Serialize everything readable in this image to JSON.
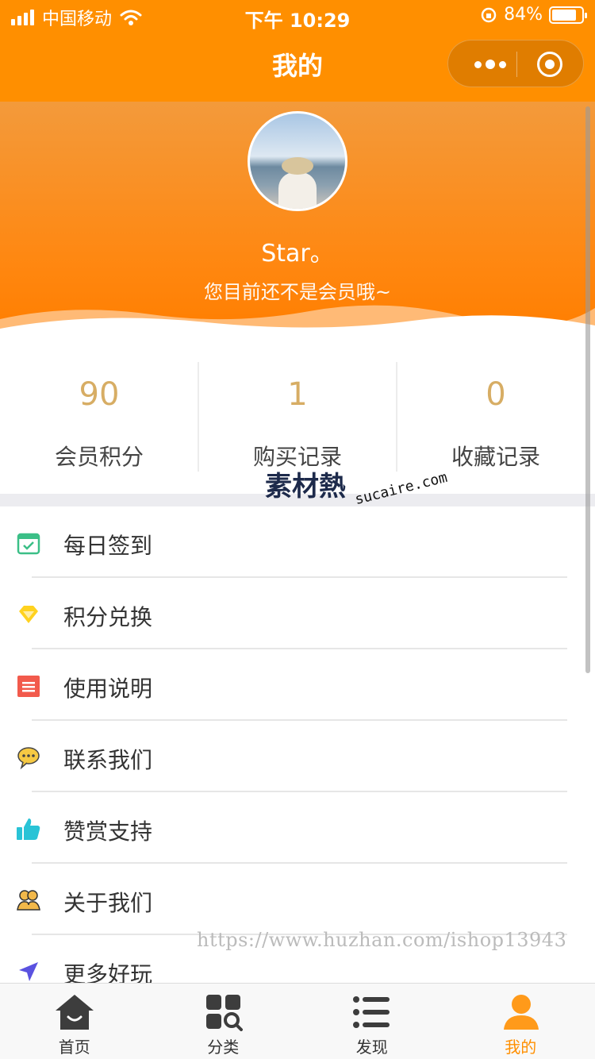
{
  "status_bar": {
    "carrier": "中国移动",
    "time": "下午 10:29",
    "battery": "84%",
    "battery_level": 0.84
  },
  "nav": {
    "title": "我的",
    "capsule_icons": [
      "more-dots-icon",
      "close-target-icon"
    ]
  },
  "profile": {
    "name": "Star。",
    "member_status": "您目前还不是会员哦~"
  },
  "stats": [
    {
      "value": "90",
      "label": "会员积分"
    },
    {
      "value": "1",
      "label": "购买记录"
    },
    {
      "value": "0",
      "label": "收藏记录"
    }
  ],
  "watermark": {
    "logo": "素材熱",
    "domain": "sucaire.com",
    "url": "https://www.huzhan.com/ishop13943"
  },
  "menu": [
    {
      "label": "每日签到",
      "icon": "calendar-check-icon",
      "color": "#3bbf87"
    },
    {
      "label": "积分兑换",
      "icon": "diamond-icon",
      "color": "#ffd21f"
    },
    {
      "label": "使用说明",
      "icon": "document-list-icon",
      "color": "#f25a4c"
    },
    {
      "label": "联系我们",
      "icon": "chat-bubble-icon",
      "color": "#f6c943"
    },
    {
      "label": "赞赏支持",
      "icon": "thumbs-up-icon",
      "color": "#29c3d6"
    },
    {
      "label": "关于我们",
      "icon": "users-icon",
      "color": "#f2b84a"
    },
    {
      "label": "更多好玩",
      "icon": "send-arrow-icon",
      "color": "#5a52e0"
    }
  ],
  "tabbar": [
    {
      "label": "首页",
      "icon": "home-icon",
      "active": false
    },
    {
      "label": "分类",
      "icon": "category-search-icon",
      "active": false
    },
    {
      "label": "发现",
      "icon": "list-icon",
      "active": false
    },
    {
      "label": "我的",
      "icon": "user-icon",
      "active": true
    }
  ],
  "colors": {
    "accent": "#ff8f00",
    "stat_number": "#d7ad64"
  }
}
